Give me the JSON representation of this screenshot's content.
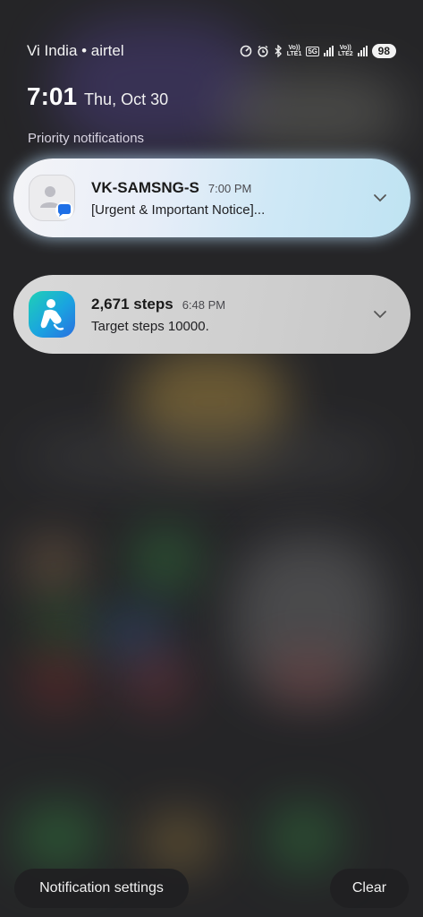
{
  "status_bar": {
    "carrier": "Vi India • airtel",
    "volte1": "Vo))\nLTE1",
    "network": "5G",
    "volte2": "Vo))\nLTE2",
    "battery": "98"
  },
  "lockscreen": {
    "time": "7:01",
    "date": "Thu, Oct 30",
    "section_label": "Priority notifications"
  },
  "notifications": [
    {
      "title": "VK-SAMSNG-S",
      "time": "7:00 PM",
      "body": "[Urgent & Important Notice]...",
      "icon": "messages-icon"
    },
    {
      "title": "2,671 steps",
      "time": "6:48 PM",
      "body": "Target steps 10000.",
      "icon": "samsung-health-icon"
    }
  ],
  "footer": {
    "settings_label": "Notification settings",
    "clear_label": "Clear"
  },
  "colors": {
    "health_gradient_start": "#1fd0b6",
    "health_gradient_end": "#2a6fe0",
    "message_badge": "#1e6fe6"
  }
}
